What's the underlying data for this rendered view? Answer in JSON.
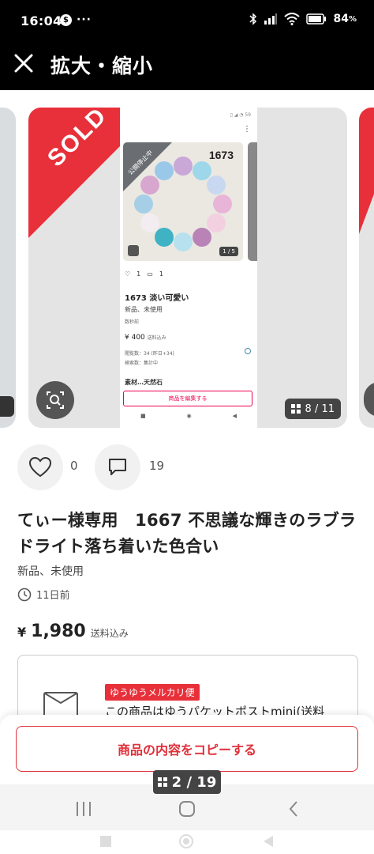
{
  "status_bar": {
    "time": "16:04",
    "app_badge": "$",
    "dots": "···",
    "battery": "84"
  },
  "title_bar": {
    "title": "拡大・縮小",
    "close_icon": "close-icon"
  },
  "carousel": {
    "sold_label": "SOLD",
    "pager": "8 / 11",
    "inner_screenshot": {
      "ribbon": "公開停止中",
      "number": "1673",
      "photo_counter": "1 / 5",
      "likes": "1",
      "comments": "1",
      "title": "1673 淡い可愛い",
      "condition": "新品、未使用",
      "time": "数秒前",
      "price": "¥ 400",
      "price_note": "送料込み",
      "stat_views": "閲覧数：34 (昨日+34)",
      "stat_search": "検索数：集計中",
      "desc": "素材…天然石",
      "edit_button": "商品を編集する"
    }
  },
  "actions": {
    "likes": "0",
    "comments": "19"
  },
  "item": {
    "title": "てぃー様専用　1667 不思議な輝きのラブラドライト落ち着いた色合い",
    "condition": "新品、未使用",
    "time": "11日前",
    "price_symbol": "¥",
    "price": "1,980",
    "price_note": "送料込み"
  },
  "shipping": {
    "icon_label": "A5",
    "tag": "ゆうゆうメルカリ便",
    "text": "この商品はゆうパケットポストmini(送料"
  },
  "copy_button": "商品の内容をコピーする",
  "bottom_pager": "2 / 19",
  "colors": {
    "accent": "#e8303a",
    "dark": "#000000"
  }
}
